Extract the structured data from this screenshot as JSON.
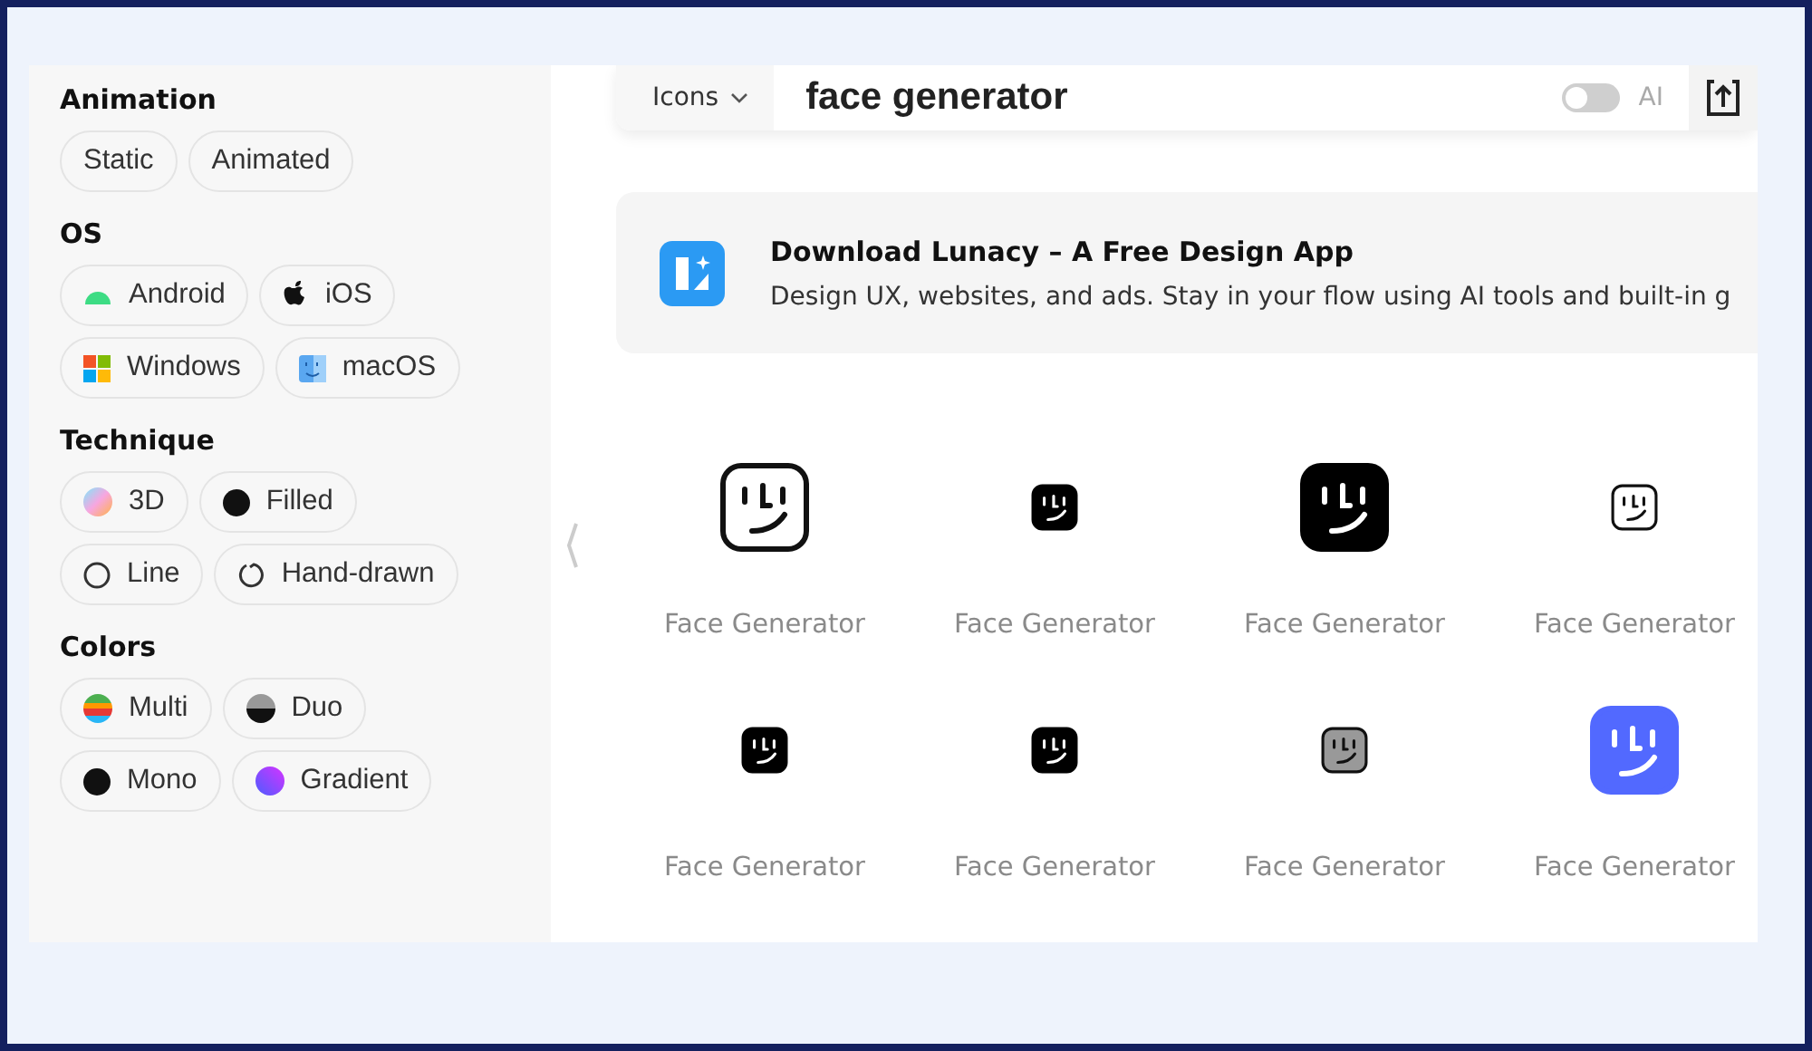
{
  "filters": [
    {
      "title": "Animation",
      "chips": [
        {
          "label": "Static",
          "kind": "none"
        },
        {
          "label": "Animated",
          "kind": "none"
        }
      ]
    },
    {
      "title": "OS",
      "chips": [
        {
          "label": "Android",
          "kind": "android"
        },
        {
          "label": "iOS",
          "kind": "apple"
        },
        {
          "label": "Windows",
          "kind": "windows"
        },
        {
          "label": "macOS",
          "kind": "finder"
        }
      ]
    },
    {
      "title": "Technique",
      "chips": [
        {
          "label": "3D",
          "kind": "sphere"
        },
        {
          "label": "Filled",
          "kind": "dot"
        },
        {
          "label": "Line",
          "kind": "ring"
        },
        {
          "label": "Hand-drawn",
          "kind": "sketch"
        }
      ]
    },
    {
      "title": "Colors",
      "chips": [
        {
          "label": "Multi",
          "kind": "multi"
        },
        {
          "label": "Duo",
          "kind": "duo"
        },
        {
          "label": "Mono",
          "kind": "dot"
        },
        {
          "label": "Gradient",
          "kind": "gradient"
        }
      ]
    }
  ],
  "search": {
    "category": "Icons",
    "value": "face generator",
    "ai_label": "AI",
    "ai_on": false
  },
  "banner": {
    "title": "Download Lunacy – A Free Design App",
    "text": "Design UX, websites, and ads. Stay in your flow using AI tools and built-in g"
  },
  "icons": [
    {
      "label": "Face Generator",
      "kind": "outline",
      "large": true
    },
    {
      "label": "Face Generator",
      "kind": "solid",
      "large": false
    },
    {
      "label": "Face Generator",
      "kind": "solid",
      "large": true
    },
    {
      "label": "Face Generator",
      "kind": "outline",
      "large": false
    },
    {
      "label": "Face Generator",
      "kind": "solid",
      "large": false
    },
    {
      "label": "Face Generator",
      "kind": "solid",
      "large": false
    },
    {
      "label": "Face Generator",
      "kind": "grey",
      "large": false
    },
    {
      "label": "Face Generator",
      "kind": "blue",
      "large": true
    }
  ]
}
